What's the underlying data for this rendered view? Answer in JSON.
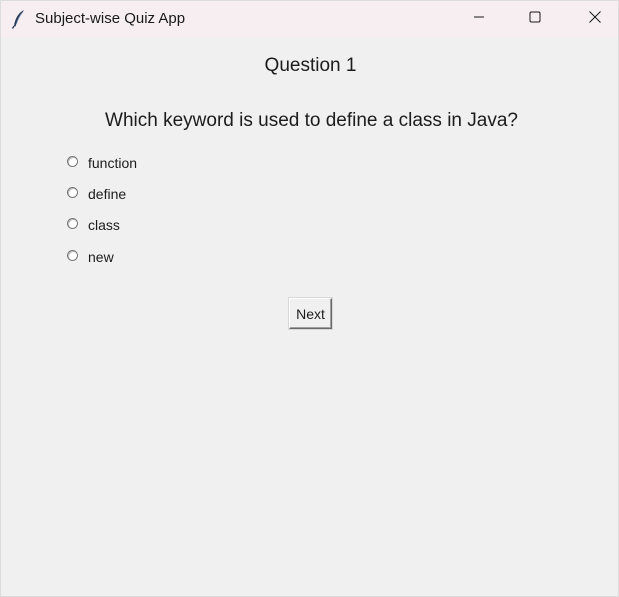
{
  "window": {
    "title": "Subject-wise Quiz App",
    "icon": "feather-icon",
    "controls": {
      "minimize": "minimize-icon",
      "maximize": "maximize-icon",
      "close": "close-icon"
    }
  },
  "quiz": {
    "question_number": "Question 1",
    "question_text": "Which keyword is used to define a class in Java?",
    "options": [
      {
        "label": "function",
        "selected": false
      },
      {
        "label": "define",
        "selected": false
      },
      {
        "label": "class",
        "selected": false
      },
      {
        "label": "new",
        "selected": false
      }
    ],
    "next_label": "Next"
  }
}
